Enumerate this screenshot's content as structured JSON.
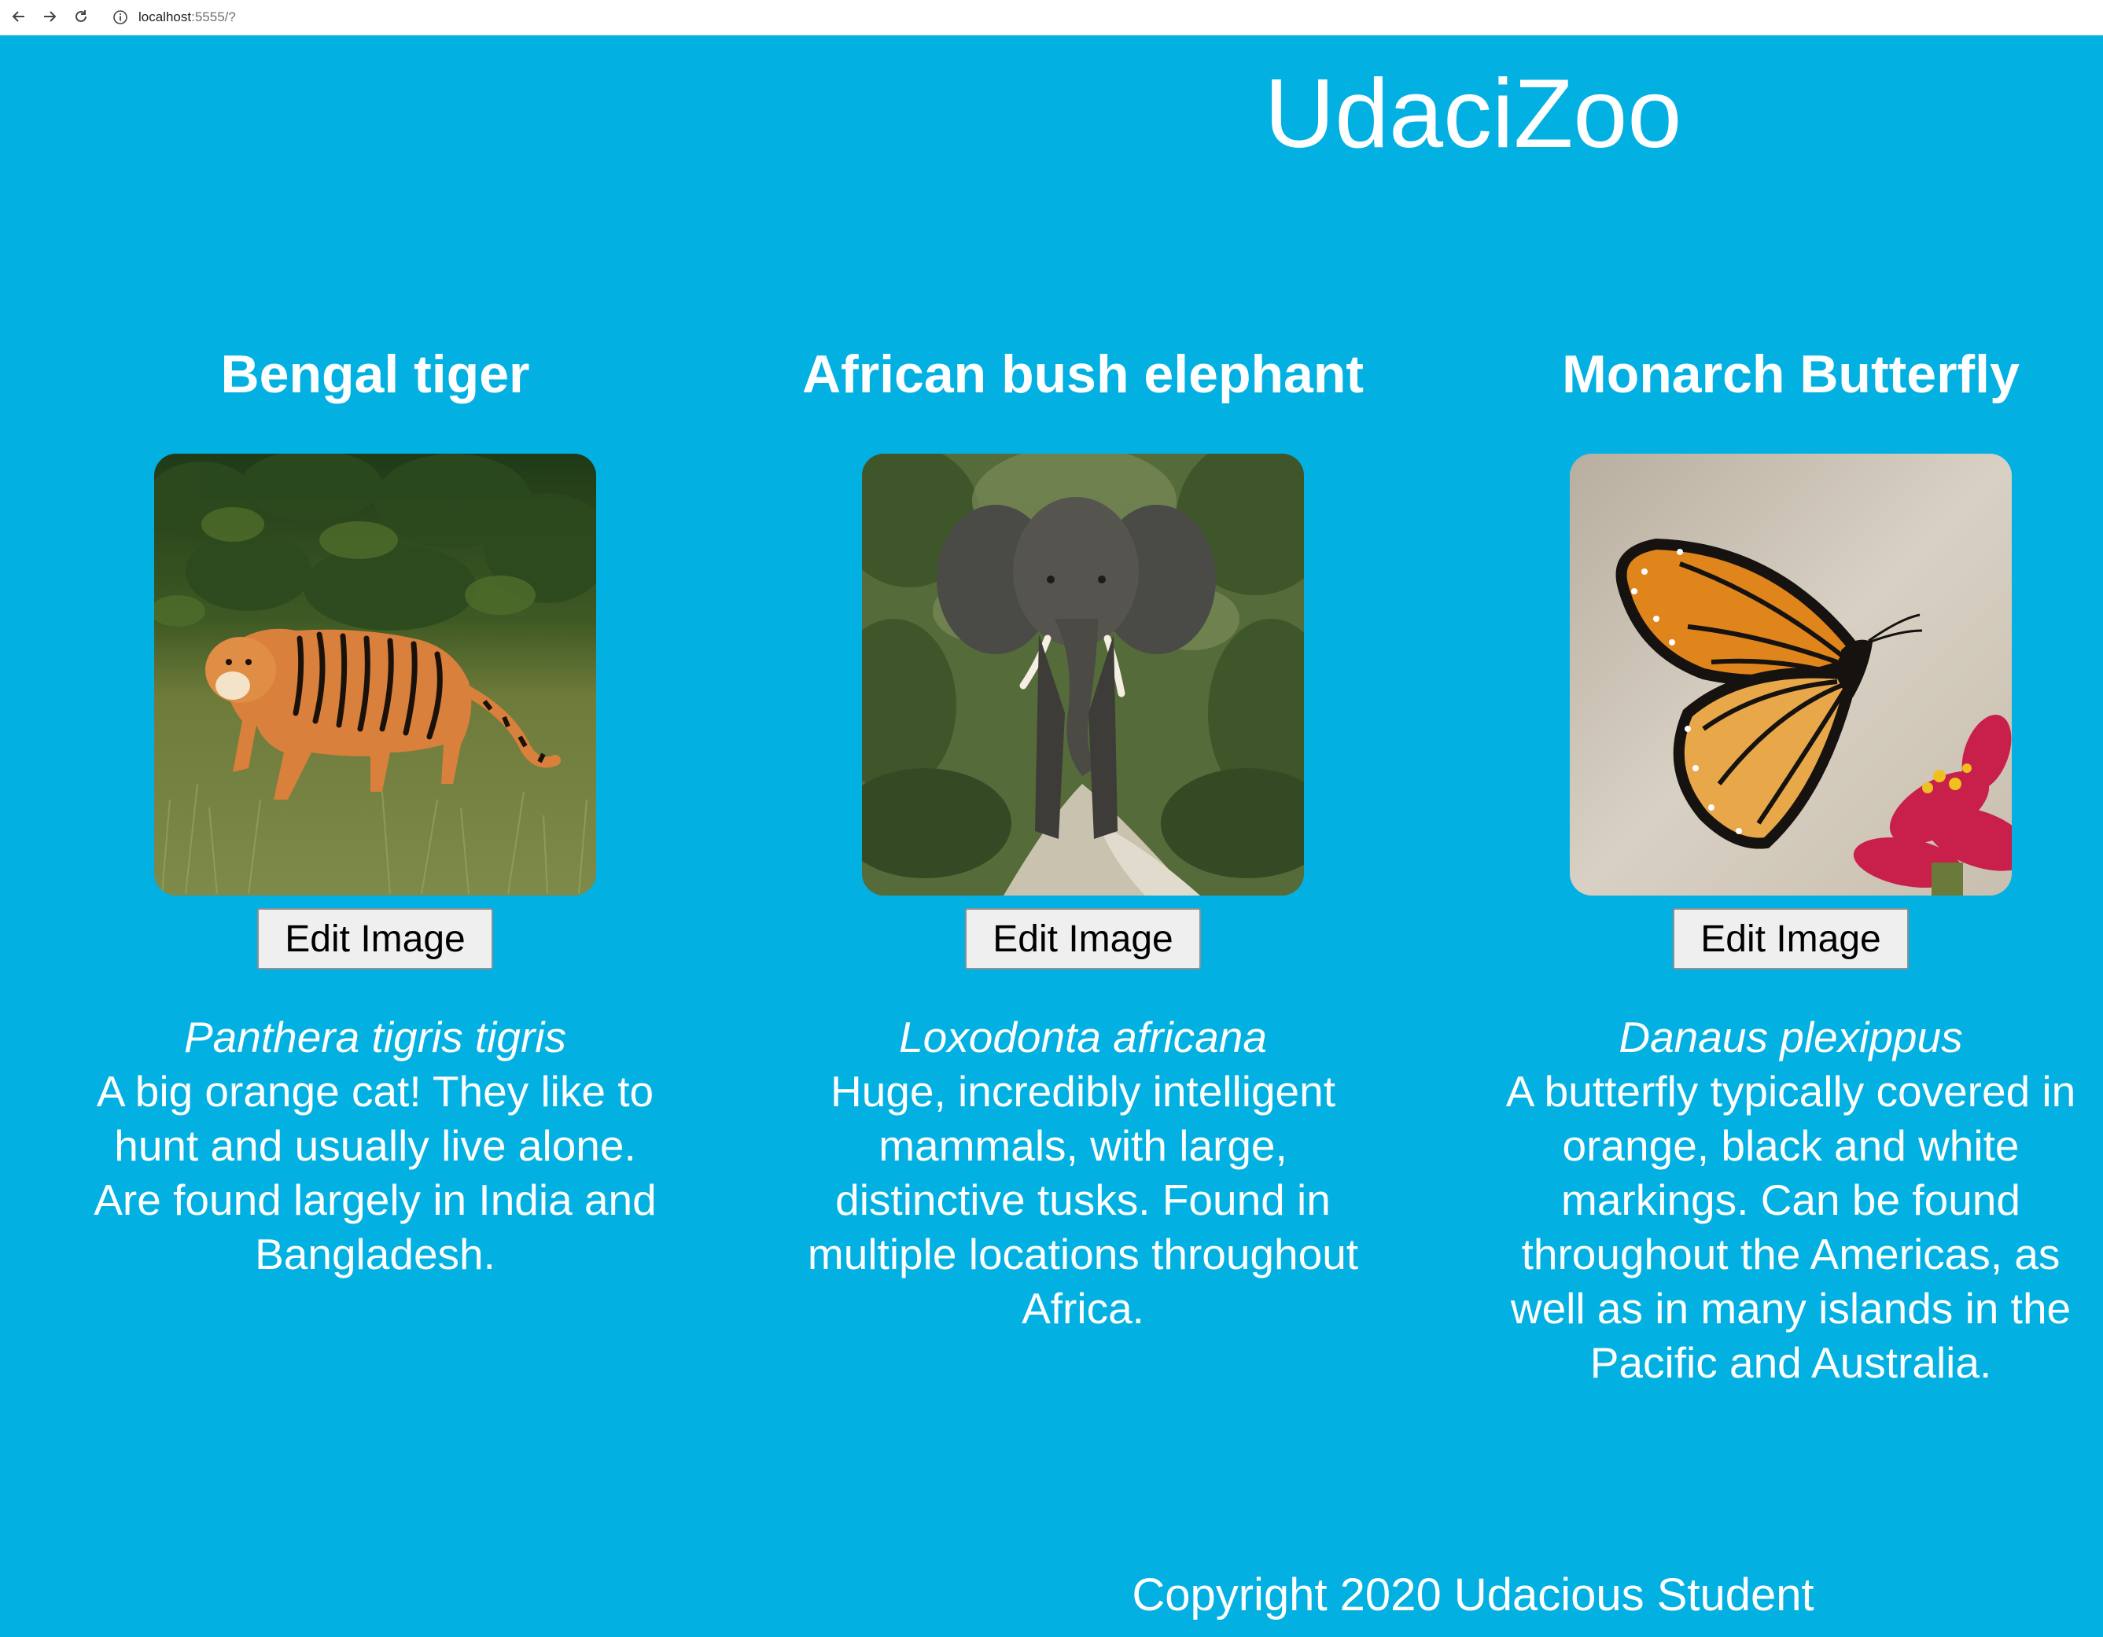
{
  "browser": {
    "url_host": "localhost",
    "url_path": ":5555/?"
  },
  "site": {
    "title": "UdaciZoo",
    "footer": "Copyright 2020 Udacious Student"
  },
  "animals": [
    {
      "name": "Bengal tiger",
      "scientific_name": "Panthera tigris tigris",
      "description": "A big orange cat! They like to hunt and usually live alone. Are found largely in India and Bangladesh.",
      "button_label": "Edit Image"
    },
    {
      "name": "African bush elephant",
      "scientific_name": "Loxodonta africana",
      "description": "Huge, incredibly intelligent mammals, with large, distinctive tusks. Found in multiple locations throughout Africa.",
      "button_label": "Edit Image"
    },
    {
      "name": "Monarch Butterfly",
      "scientific_name": "Danaus plexippus",
      "description": "A butterfly typically covered in orange, black and white markings. Can be found throughout the Americas, as well as in many islands in the Pacific and Australia.",
      "button_label": "Edit Image"
    }
  ],
  "colors": {
    "page_background": "#03b0e2",
    "text": "#ffffff",
    "button_background": "#efefef"
  }
}
